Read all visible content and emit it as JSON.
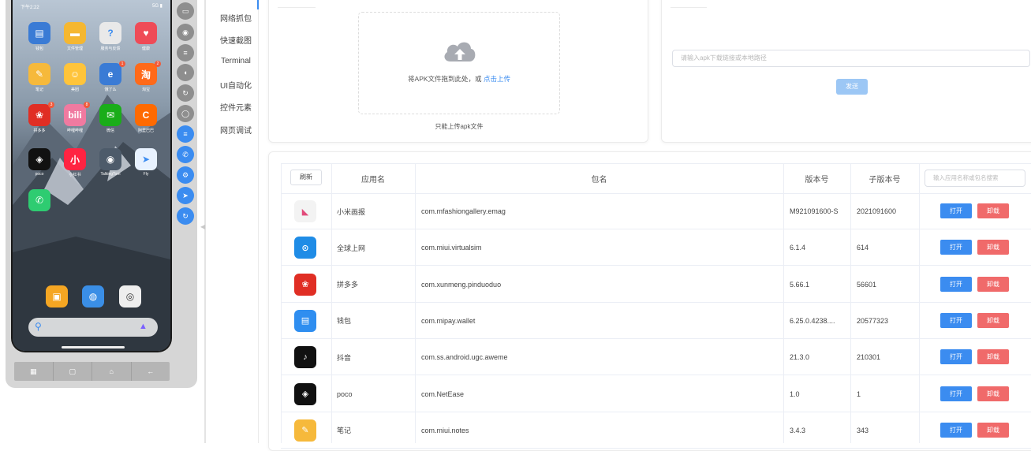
{
  "phone": {
    "status_time": "下午2:22",
    "status_right": "5G ▮",
    "apps": [
      {
        "label": "钱包",
        "icon": "wallet-icon",
        "color": "#3a7bd5",
        "glyph": "▤",
        "badge": ""
      },
      {
        "label": "文件管理",
        "icon": "folder-icon",
        "color": "#f5b731",
        "glyph": "▬",
        "badge": ""
      },
      {
        "label": "服务与反馈",
        "icon": "feedback-icon",
        "color": "#e9e9e9",
        "glyph": "?",
        "badge": ""
      },
      {
        "label": "健康",
        "icon": "health-icon",
        "color": "#ef4b57",
        "glyph": "♥",
        "badge": ""
      },
      {
        "label": "笔记",
        "icon": "notes-icon",
        "color": "#f6b93b",
        "glyph": "✎",
        "badge": ""
      },
      {
        "label": "美团",
        "icon": "meituan-icon",
        "color": "#ffc43b",
        "glyph": "☺",
        "badge": ""
      },
      {
        "label": "饿了么",
        "icon": "eleme-icon",
        "color": "#3a7bd5",
        "glyph": "e",
        "badge": "1"
      },
      {
        "label": "淘宝",
        "icon": "taobao-icon",
        "color": "#ff6a1a",
        "glyph": "淘",
        "badge": "2"
      },
      {
        "label": "拼多多",
        "icon": "pinduoduo-icon",
        "color": "#e02e24",
        "glyph": "❀",
        "badge": "3"
      },
      {
        "label": "哔哩哔哩",
        "icon": "bilibili-icon",
        "color": "#f07aa0",
        "glyph": "bili",
        "badge": "8"
      },
      {
        "label": "微信",
        "icon": "wechat-icon",
        "color": "#1aad19",
        "glyph": "✉",
        "badge": ""
      },
      {
        "label": "阿里巴巴",
        "icon": "alibaba-icon",
        "color": "#ff6a00",
        "glyph": "C",
        "badge": ""
      },
      {
        "label": "poco",
        "icon": "unity-icon",
        "color": "#111111",
        "glyph": "◈",
        "badge": ""
      },
      {
        "label": "小红书",
        "icon": "xiaohongshu-icon",
        "color": "#ff2442",
        "glyph": "小",
        "badge": ""
      },
      {
        "label": "TalkingTom",
        "icon": "game-icon",
        "color": "#4d5b6a",
        "glyph": "◉",
        "badge": ""
      },
      {
        "label": "Fly",
        "icon": "paper-plane-icon",
        "color": "#e8f2ff",
        "glyph": "➤",
        "badge": ""
      },
      {
        "label": "",
        "icon": "phone-call-icon",
        "color": "#2ecc71",
        "glyph": "✆",
        "badge": ""
      }
    ],
    "dock": [
      {
        "icon": "gallery-icon",
        "color": "#f5a623",
        "glyph": "▣"
      },
      {
        "icon": "browser-icon",
        "color": "#3a8ee6",
        "glyph": "◍"
      },
      {
        "icon": "camera-icon",
        "color": "#eeeeee",
        "glyph": "◎"
      }
    ]
  },
  "menu": {
    "items": [
      "网络抓包",
      "快速截图",
      "Terminal",
      "UI自动化",
      "控件元素",
      "网页调试"
    ]
  },
  "upload": {
    "drop_text": "将APK文件拖到此处，或",
    "drop_link": "点击上传",
    "tip": "只能上传apk文件"
  },
  "url_form": {
    "placeholder": "请输入apk下载链接或本地路径",
    "send_label": "发送"
  },
  "table": {
    "refresh_label": "刷新",
    "headers": {
      "name": "应用名",
      "package": "包名",
      "version": "版本号",
      "subversion": "子版本号"
    },
    "search_placeholder": "输入应用名称或包名搜索",
    "open_label": "打开",
    "uninstall_label": "卸载",
    "rows": [
      {
        "name": "小米画报",
        "package": "com.mfashiongallery.emag",
        "version": "M921091600-S",
        "subversion": "2021091600",
        "icon": "mi-gallery-icon",
        "color": "#f3f3f3",
        "glyph": "◣"
      },
      {
        "name": "全球上网",
        "package": "com.miui.virtualsim",
        "version": "6.1.4",
        "subversion": "614",
        "icon": "global-net-icon",
        "color": "#1f8ce6",
        "glyph": "⊙"
      },
      {
        "name": "拼多多",
        "package": "com.xunmeng.pinduoduo",
        "version": "5.66.1",
        "subversion": "56601",
        "icon": "pinduoduo-icon",
        "color": "#e02e24",
        "glyph": "❀"
      },
      {
        "name": "钱包",
        "package": "com.mipay.wallet",
        "version": "6.25.0.4238....",
        "subversion": "20577323",
        "icon": "wallet-icon",
        "color": "#2f8ef0",
        "glyph": "▤"
      },
      {
        "name": "抖音",
        "package": "com.ss.android.ugc.aweme",
        "version": "21.3.0",
        "subversion": "210301",
        "icon": "douyin-icon",
        "color": "#111111",
        "glyph": "♪"
      },
      {
        "name": "poco",
        "package": "com.NetEase",
        "version": "1.0",
        "subversion": "1",
        "icon": "unity-icon",
        "color": "#111111",
        "glyph": "◈"
      },
      {
        "name": "笔记",
        "package": "com.miui.notes",
        "version": "3.4.3",
        "subversion": "343",
        "icon": "notes-icon",
        "color": "#f6b93b",
        "glyph": "✎"
      }
    ]
  }
}
